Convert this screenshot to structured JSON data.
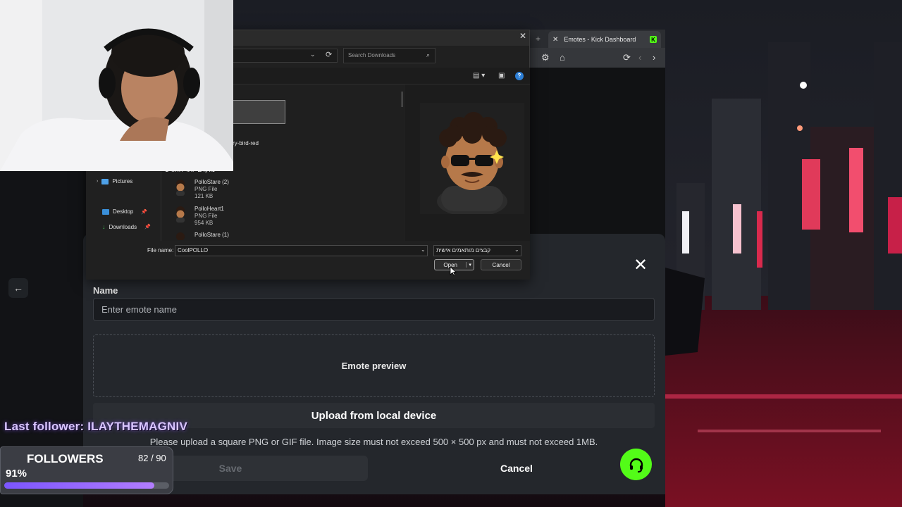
{
  "browser": {
    "tab_title": "Emotes - Kick Dashboard"
  },
  "modal": {
    "name_label": "Name",
    "name_placeholder": "Enter emote name",
    "preview_label": "Emote preview",
    "upload_title": "Upload from local device",
    "upload_hint": "Please upload a square PNG or GIF file. Image size must not exceed 500 × 500 px and must not exceed 1MB.",
    "save_label": "Save",
    "cancel_label": "Cancel"
  },
  "file_dialog": {
    "search_placeholder": "Search Downloads",
    "nav_items": [
      {
        "label": "Pictures"
      },
      {
        "label": "Desktop"
      },
      {
        "label": "Downloads"
      }
    ],
    "truncated_item": "ry-bird-red",
    "group_header": "מוקדם יותר החודש",
    "files": [
      {
        "name": "PolloStare (2)",
        "type": "PNG File",
        "size": "121 KB"
      },
      {
        "name": "PolloHeart1",
        "type": "PNG File",
        "size": "954 KB"
      },
      {
        "name": "PolloStare (1)",
        "type": "PNG File",
        "size": ""
      }
    ],
    "file_name_label": "File name:",
    "file_name_value": "CoolPOLLO",
    "file_type_value": "קבצים מותאמים אישית",
    "open_label": "Open",
    "cancel_label": "Cancel"
  },
  "overlay": {
    "last_follower": "Last follower: ILAYTHEMAGNIV",
    "followers_title": "FOLLOWERS",
    "followers_count": "82 / 90",
    "followers_percent": "91%",
    "followers_progress": 0.91
  },
  "colors": {
    "kick_green": "#53fc18",
    "progress_purple": "#8b5cff"
  }
}
